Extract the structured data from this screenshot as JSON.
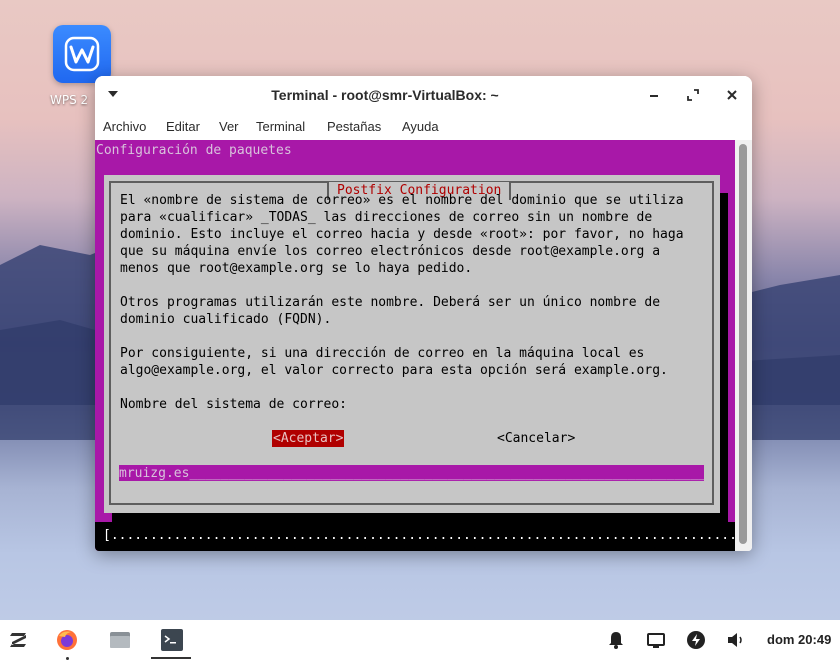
{
  "desktop": {
    "icon_label": "WPS 2",
    "icon_name": "wps-office-icon"
  },
  "window": {
    "title": "Terminal - root@smr-VirtualBox: ~",
    "menu": [
      "Archivo",
      "Editar",
      "Ver",
      "Terminal",
      "Pestañas",
      "Ayuda"
    ]
  },
  "terminal": {
    "header": "Configuración de paquetes",
    "dialog_title": "Postfix Configuration",
    "paragraphs": [
      "El «nombre de sistema de correo» es el nombre del dominio que se utiliza",
      "para «cualificar» _TODAS_ las direcciones de correo sin un nombre de",
      "dominio. Esto incluye el correo hacia y desde «root»: por favor, no haga",
      "que su máquina envíe los correo electrónicos desde root@example.org a",
      "menos que root@example.org se lo haya pedido.",
      "",
      "Otros programas utilizarán este nombre. Deberá ser un único nombre de",
      "dominio cualificado (FQDN).",
      "",
      "Por consiguiente, si una dirección de correo en la máquina local es",
      "algo@example.org, el valor correcto para esta opción será example.org.",
      "",
      "Nombre del sistema de correo:"
    ],
    "input_value": "mruizg.es",
    "input_fill": "________________________________________________________________________",
    "ok_button": "<Aceptar>",
    "cancel_button": "<Cancelar>",
    "progress": "[.................................................................................]"
  },
  "taskbar": {
    "clock": "dom 20:49",
    "icons": [
      "zorin-menu-icon",
      "firefox-icon",
      "files-icon",
      "terminal-icon",
      "notifications-icon",
      "display-icon",
      "power-icon",
      "volume-icon"
    ]
  },
  "colors": {
    "terminal_bg": "#a818a8",
    "dialog_bg": "#c6c6c6",
    "caption_red": "#b00000"
  }
}
